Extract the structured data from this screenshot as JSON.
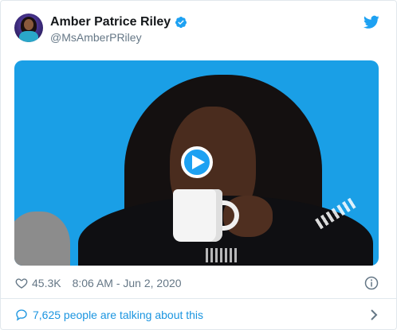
{
  "tweet": {
    "author": {
      "display_name": "Amber Patrice Riley",
      "handle": "@MsAmberPRiley",
      "verified": true
    },
    "media": {
      "type": "video",
      "background_color": "#1a9fe6"
    },
    "likes": "45.3K",
    "timestamp": "8:06 AM - Jun 2, 2020",
    "talking": "7,625 people are talking about this"
  },
  "icons": {
    "brand": "twitter-bird-icon",
    "verified": "verified-badge-icon",
    "like": "heart-outline-icon",
    "info": "info-icon",
    "reply": "speech-bubble-icon",
    "chevron": "chevron-right-icon",
    "play": "play-icon"
  },
  "colors": {
    "accent": "#1da1f2",
    "link": "#1b95e0",
    "secondary_text": "#657786",
    "primary_text": "#14171a"
  }
}
